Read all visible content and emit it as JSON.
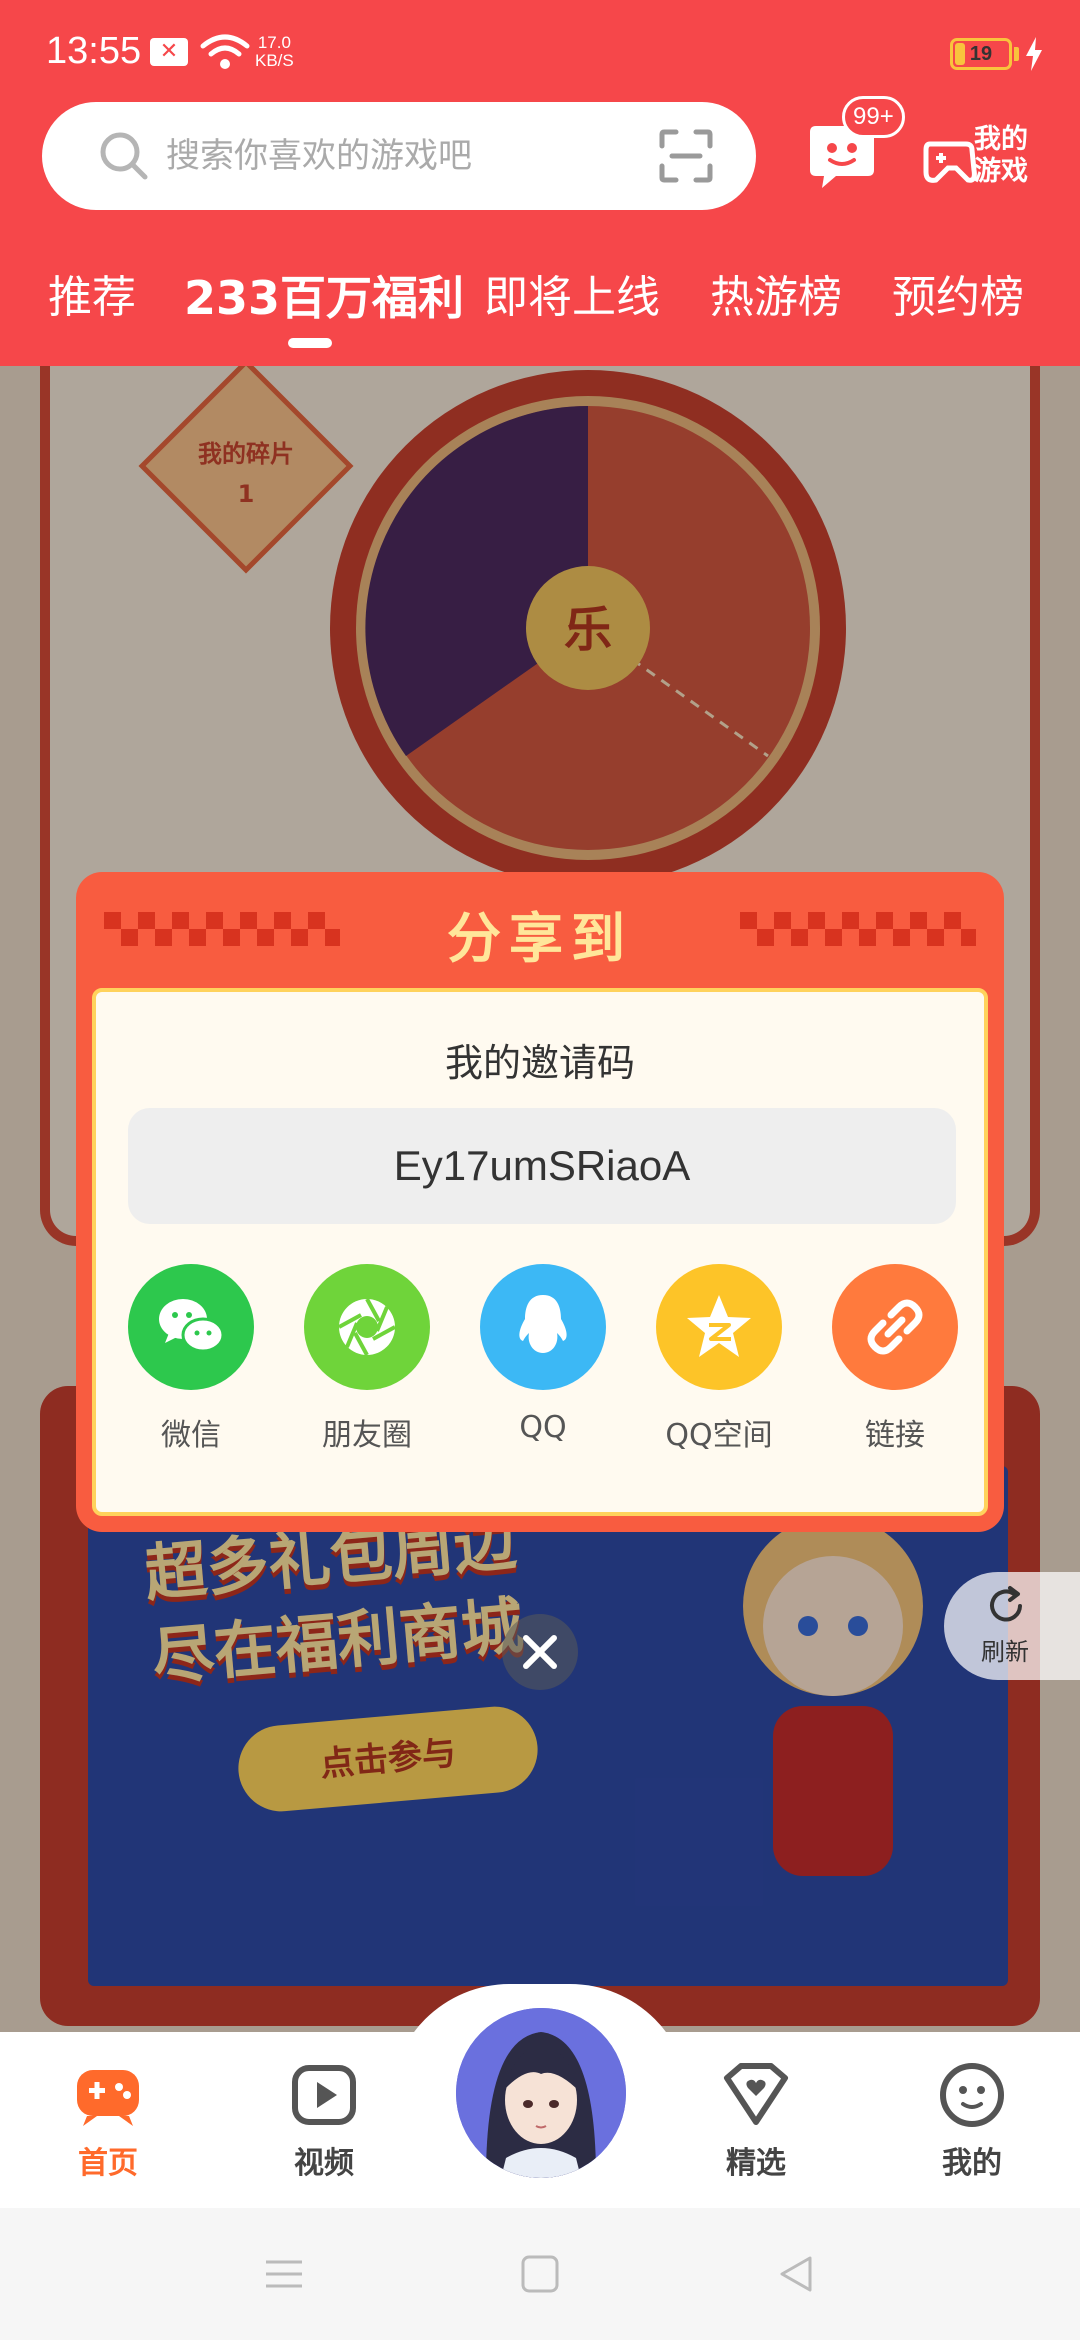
{
  "status_bar": {
    "time": "13:55",
    "net_speed_value": "17.0",
    "net_speed_unit": "KB/S",
    "battery_level": "19",
    "battery_fraction": 0.19
  },
  "search": {
    "placeholder": "搜索你喜欢的游戏吧"
  },
  "header": {
    "message_badge": "99+",
    "my_games_label": "我的游戏"
  },
  "tabs": [
    {
      "label": "推荐"
    },
    {
      "label": "233百万福利"
    },
    {
      "label": "即将上线"
    },
    {
      "label": "热游榜"
    },
    {
      "label": "预约榜"
    }
  ],
  "active_tab_index": 1,
  "background": {
    "fragment_label": "我的碎片",
    "fragment_count": "1",
    "wheel_center": "乐",
    "banner_title_line1": "超多礼包周边",
    "banner_title_line2": "尽在福利商城",
    "banner_cta": "点击参与",
    "refresh_label": "刷新"
  },
  "share_dialog": {
    "title": "分享到",
    "invite_label": "我的邀请码",
    "invite_code": "Ey17umSRiaoA",
    "targets": [
      {
        "label": "微信",
        "color": "#2dc84d",
        "icon": "wechat-icon"
      },
      {
        "label": "朋友圈",
        "color": "#6fd43a",
        "icon": "moments-icon"
      },
      {
        "label": "QQ",
        "color": "#3cb8f5",
        "icon": "qq-icon"
      },
      {
        "label": "QQ空间",
        "color": "#fdc428",
        "icon": "qzone-icon"
      },
      {
        "label": "链接",
        "color": "#ff7a3d",
        "icon": "link-icon"
      }
    ]
  },
  "bottom_nav": {
    "items": [
      {
        "label": "首页",
        "icon": "gamepad-icon",
        "active": true
      },
      {
        "label": "视频",
        "icon": "video-icon",
        "active": false
      },
      {
        "label": "精选",
        "icon": "heart-badge-icon",
        "active": false
      },
      {
        "label": "我的",
        "icon": "face-icon",
        "active": false
      }
    ],
    "accent_color": "#ff6a2b"
  },
  "colors": {
    "header_bg": "#f6474a",
    "dialog_bg": "#f85c40",
    "dialog_title": "#ffe69a"
  }
}
